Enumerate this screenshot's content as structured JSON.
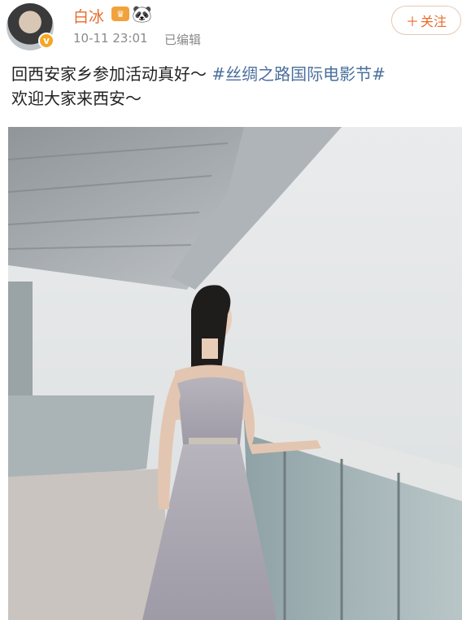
{
  "user": {
    "name": "白冰",
    "badge_crown": "♛",
    "badge_panda": "🐼",
    "verified_symbol": "v"
  },
  "post": {
    "timestamp": "10-11 23:01",
    "edited": "已编辑",
    "text_line1_plain": "回西安家乡参加活动真好～ ",
    "hashtag": "#丝绸之路国际电影节#",
    "text_line2": "欢迎大家来西安～"
  },
  "follow": {
    "plus": "＋",
    "label": "关注"
  },
  "colors": {
    "accent": "#e86b2b",
    "hashtag": "#4a6f9c",
    "meta": "#8a8a8a"
  }
}
